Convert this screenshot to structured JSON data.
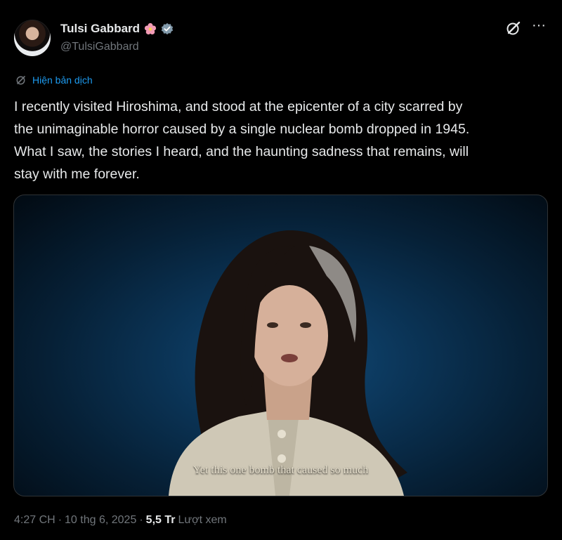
{
  "author": {
    "display_name": "Tulsi Gabbard",
    "handle": "@TulsiGabbard",
    "flower_emoji_icon": "hibiscus-icon",
    "verified_badge_icon": "gray-verified-icon"
  },
  "header_actions": {
    "grok_icon": "grok-icon",
    "more_label": "···"
  },
  "translate": {
    "label": "Hiện bản dịch"
  },
  "tweet": {
    "text": "I recently visited Hiroshima, and stood at the epicenter of a city scarred by\nthe unimaginable horror caused by a single nuclear bomb dropped in 1945.\nWhat I saw, the stories I heard, and the haunting sadness that remains, will\nstay with me forever."
  },
  "media": {
    "subtitle": "Yet this one bomb that caused so much"
  },
  "meta": {
    "time": "4:27 CH",
    "separator1": "·",
    "date": "10 thg 6, 2025",
    "separator2": "·",
    "views_count": "5,5 Tr",
    "views_label": "Lượt xem"
  },
  "colors": {
    "background": "#000000",
    "text": "#e7e9ea",
    "muted": "#71767b",
    "link": "#1d9bf0"
  }
}
